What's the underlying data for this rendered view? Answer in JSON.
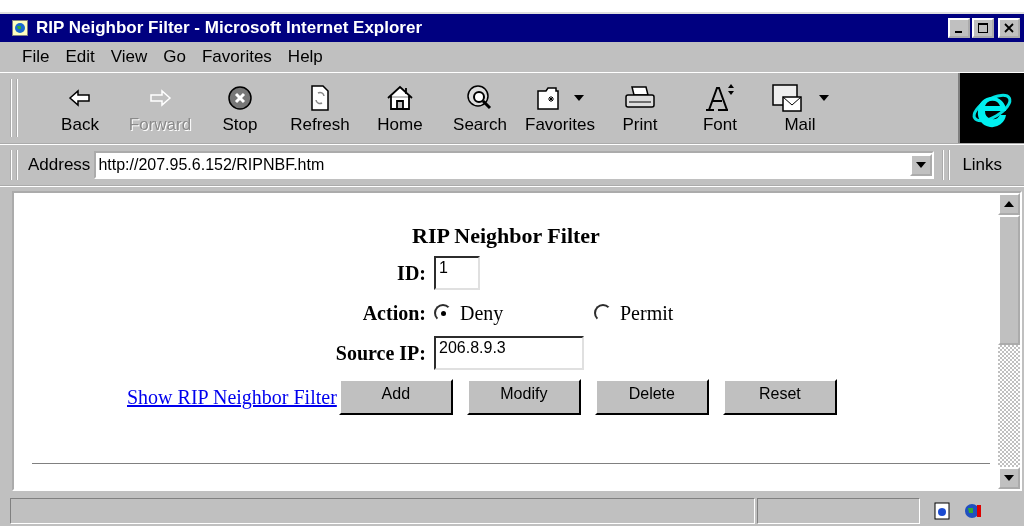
{
  "window": {
    "title": "RIP Neighbor Filter - Microsoft Internet Explorer"
  },
  "menu": [
    {
      "label": "File"
    },
    {
      "label": "Edit"
    },
    {
      "label": "View"
    },
    {
      "label": "Go"
    },
    {
      "label": "Favorites"
    },
    {
      "label": "Help"
    }
  ],
  "toolbar": [
    {
      "label": "Back",
      "disabled": false,
      "dropdown": false
    },
    {
      "label": "Forward",
      "disabled": true,
      "dropdown": false
    },
    {
      "label": "Stop",
      "disabled": false,
      "dropdown": false
    },
    {
      "label": "Refresh",
      "disabled": false,
      "dropdown": false
    },
    {
      "label": "Home",
      "disabled": false,
      "dropdown": false
    },
    {
      "label": "Search",
      "disabled": false,
      "dropdown": false
    },
    {
      "label": "Favorites",
      "disabled": false,
      "dropdown": true
    },
    {
      "label": "Print",
      "disabled": false,
      "dropdown": false
    },
    {
      "label": "Font",
      "disabled": false,
      "dropdown": false
    },
    {
      "label": "Mail",
      "disabled": false,
      "dropdown": true
    }
  ],
  "address_bar": {
    "label": "Address",
    "value": "http://207.95.6.152/RIPNBF.htm",
    "links": "Links"
  },
  "page": {
    "heading": "RIP Neighbor Filter",
    "id": {
      "label": "ID:",
      "value": "1"
    },
    "action": {
      "label": "Action:",
      "options": [
        {
          "label": "Deny",
          "selected": true
        },
        {
          "label": "Permit",
          "selected": false
        }
      ]
    },
    "source_ip": {
      "label": "Source IP:",
      "value": "206.8.9.3"
    },
    "link": "Show RIP Neighbor Filter",
    "buttons": [
      "Add",
      "Modify",
      "Delete",
      "Reset"
    ]
  }
}
